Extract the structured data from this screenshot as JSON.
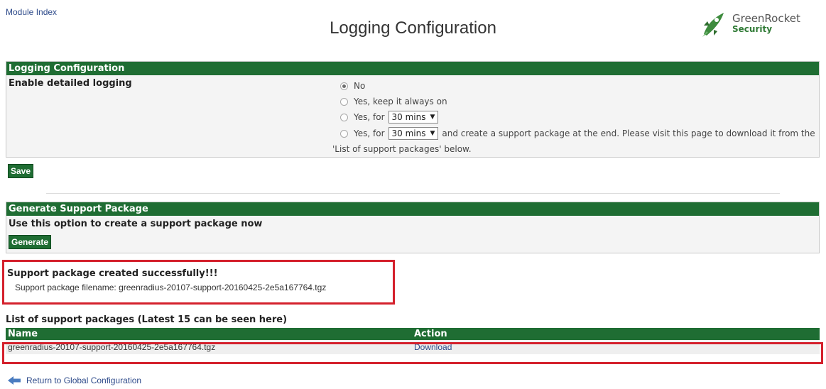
{
  "header": {
    "module_index": "Module Index",
    "title": "Logging Configuration",
    "logo_line1": "GreenRocket",
    "logo_line2": "Security"
  },
  "logging": {
    "panel_title": "Logging Configuration",
    "field_label": "Enable detailed logging",
    "options": [
      {
        "label": "No",
        "checked": true
      },
      {
        "label": "Yes, keep it always on",
        "checked": false
      },
      {
        "label_prefix": "Yes, for",
        "duration": "30 mins",
        "checked": false
      },
      {
        "label_prefix": "Yes, for",
        "duration": "30 mins",
        "label_suffix": "and create a support package at the end. Please visit this page to download it from the",
        "label_line2": "'List of support packages' below.",
        "checked": false
      }
    ],
    "save_label": "Save"
  },
  "generate": {
    "panel_title": "Generate Support Package",
    "description": "Use this option to create a support package now",
    "button_label": "Generate"
  },
  "result": {
    "heading": "Support package created successfully!!!",
    "filename_line": "Support package filename: greenradius-20107-support-20160425-2e5a167764.tgz"
  },
  "packages": {
    "heading": "List of support packages (Latest 15 can be seen here)",
    "columns": [
      "Name",
      "Action"
    ],
    "rows": [
      {
        "name": "greenradius-20107-support-20160425-2e5a167764.tgz",
        "action": "Download"
      }
    ]
  },
  "footer": {
    "return_label": "Return to Global Configuration"
  },
  "colors": {
    "header_green": "#1f6d33",
    "highlight_red": "#d4202c",
    "link_blue": "#2d4a8a"
  }
}
